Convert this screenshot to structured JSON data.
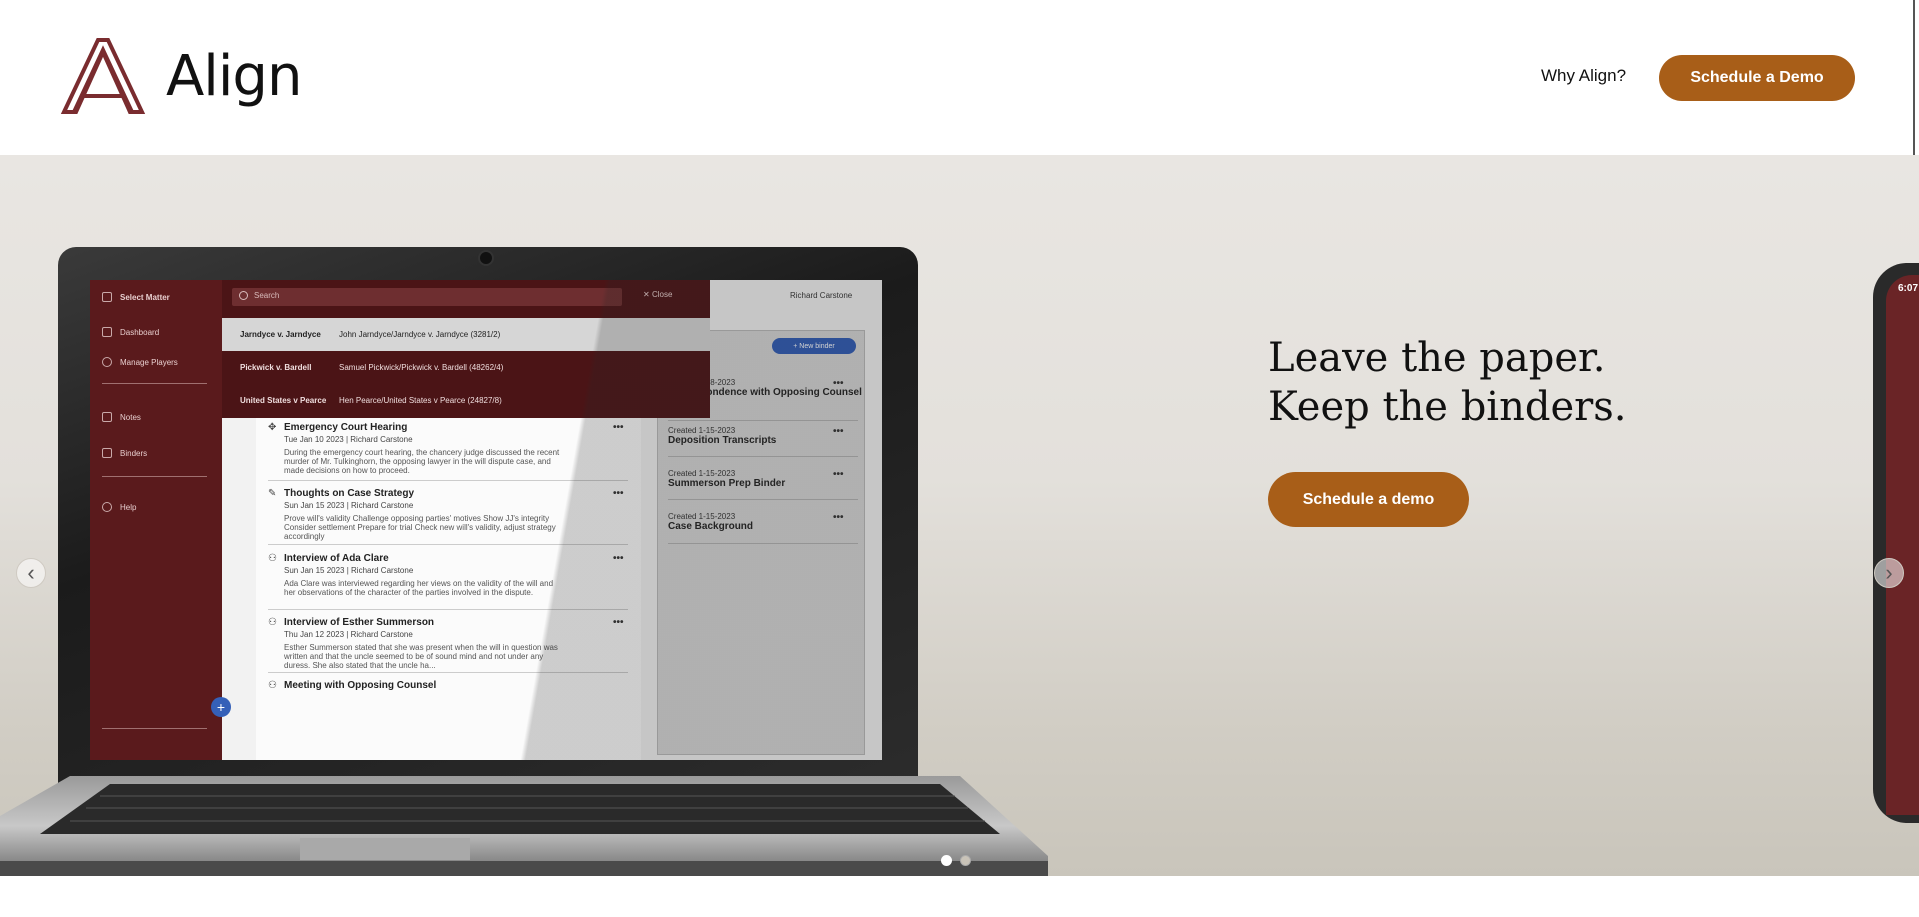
{
  "header": {
    "brand": "Align",
    "nav_link": "Why Align?",
    "cta": "Schedule a Demo"
  },
  "hero": {
    "headline_line1": "Leave the paper.",
    "headline_line2": "Keep the binders.",
    "cta": "Schedule a demo",
    "carousel": {
      "total_slides": 2,
      "active_slide": 1
    }
  },
  "app_screen": {
    "sidebar": {
      "select_matter": "Select Matter",
      "items": [
        "Dashboard",
        "Manage Players",
        "Notes",
        "Binders",
        "Help"
      ]
    },
    "search_placeholder": "Search",
    "close_label": "Close",
    "user_name": "Richard Carstone",
    "search_results": [
      {
        "name": "Jarndyce v. Jarndyce",
        "desc": "John Jarndyce/Jarndyce v. Jarndyce   (3281/2)"
      },
      {
        "name": "Pickwick v. Bardell",
        "desc": "Samuel Pickwick/Pickwick v. Bardell   (48262/4)"
      },
      {
        "name": "United States v Pearce",
        "desc": "Hen Pearce/United States v Pearce   (24827/8)"
      }
    ],
    "notes": [
      {
        "title": "Emergency Court Hearing",
        "meta": "Tue Jan 10 2023    |    Richard Carstone",
        "body": "During the emergency court hearing, the chancery judge discussed the recent murder of Mr. Tulkinghorn, the opposing lawyer in the will dispute case, and made decisions on how to proceed."
      },
      {
        "title": "Thoughts on Case Strategy",
        "meta": "Sun Jan 15 2023    |    Richard Carstone",
        "body": "Prove will's validity Challenge opposing parties' motives Show JJ's integrity Consider settlement Prepare for trial Check new will's validity, adjust strategy accordingly"
      },
      {
        "title": "Interview of Ada Clare",
        "meta": "Sun Jan 15 2023    |    Richard Carstone",
        "body": "Ada Clare was interviewed regarding her views on the validity of the will and her observations of the character of the parties involved in the dispute."
      },
      {
        "title": "Interview of Esther Summerson",
        "meta": "Thu Jan 12 2023    |    Richard Carstone",
        "body": "Esther Summerson stated that she was present when the will in question was written and that the uncle seemed to be of sound mind and not under any duress. She also stated that the uncle ha..."
      },
      {
        "title": "Meeting with Opposing Counsel",
        "meta": "",
        "body": ""
      }
    ],
    "new_binder": "+ New binder",
    "binders": [
      {
        "created": "Created 1-18-2023",
        "title": "Correspondence with Opposing Counsel"
      },
      {
        "created": "Created 1-15-2023",
        "title": "Deposition Transcripts"
      },
      {
        "created": "Created 1-15-2023",
        "title": "Summerson Prep Binder"
      },
      {
        "created": "Created 1-15-2023",
        "title": "Case Background"
      }
    ],
    "phone_time": "6:07"
  },
  "colors": {
    "accent": "#a85e18",
    "brand_maroon": "#7a2c2f",
    "app_sidebar": "#5a1a1c"
  }
}
